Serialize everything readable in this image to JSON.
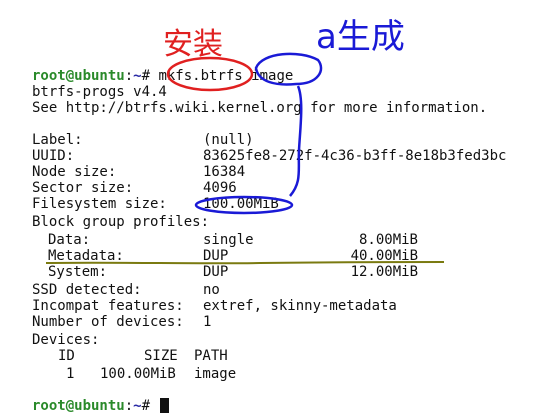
{
  "prompt": {
    "user_host": "root@ubuntu",
    "sep": ":",
    "dir": "~",
    "symbol": "# "
  },
  "command": "mkfs.btrfs image",
  "header_lines": [
    "btrfs-progs v4.4",
    "See http://btrfs.wiki.kernel.org for more information."
  ],
  "fields": [
    {
      "label": "Label:",
      "value": "(null)"
    },
    {
      "label": "UUID:",
      "value": "83625fe8-272f-4c36-b3ff-8e18b3fed3bc"
    },
    {
      "label": "Node size:",
      "value": "16384"
    },
    {
      "label": "Sector size:",
      "value": "4096"
    },
    {
      "label": "Filesystem size:",
      "value": "100.00MiB"
    }
  ],
  "block_group_title": "Block group profiles:",
  "block_groups": [
    {
      "name": "Data:",
      "profile": "single",
      "size": "8.00MiB"
    },
    {
      "name": "Metadata:",
      "profile": "DUP",
      "size": "40.00MiB"
    },
    {
      "name": "System:",
      "profile": "DUP",
      "size": "12.00MiB"
    }
  ],
  "more_fields": [
    {
      "label": "SSD detected:",
      "value": "no"
    },
    {
      "label": "Incompat features:",
      "value": "extref, skinny-metadata"
    },
    {
      "label": "Number of devices:",
      "value": "1"
    }
  ],
  "devices_title": "Devices:",
  "devices_header": {
    "id": "ID",
    "size": "SIZE",
    "path": "PATH"
  },
  "devices": [
    {
      "id": "1",
      "size": "100.00MiB",
      "path": "image"
    }
  ],
  "annotations": {
    "install_text": "安装",
    "generate_text": "a生成",
    "red": "#e02020",
    "blue": "#1a1ad6",
    "olive": "#7a7a10"
  }
}
